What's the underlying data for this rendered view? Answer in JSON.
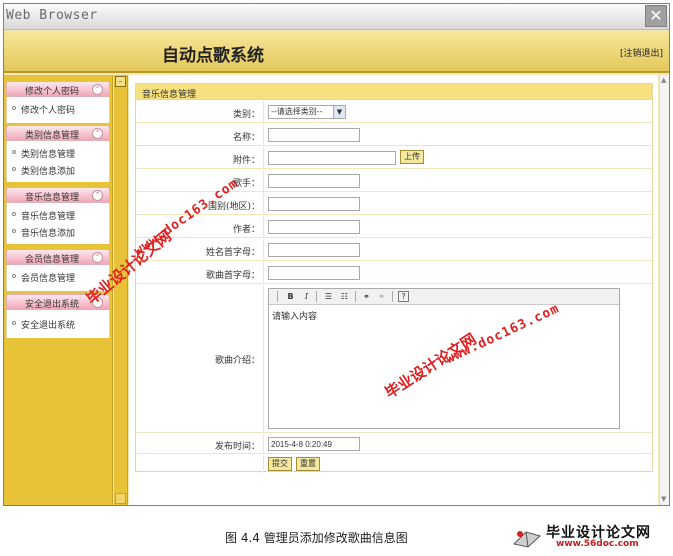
{
  "window": {
    "title": "Web Browser",
    "close_glyph": "✕"
  },
  "app": {
    "title": "自动点歌系统",
    "logout": "[注销退出]"
  },
  "sidebar": {
    "groups": [
      {
        "header": "修改个人密码",
        "items": [
          "修改个人密码"
        ]
      },
      {
        "header": "类别信息管理",
        "items": [
          "类别信息管理",
          "类别信息添加"
        ]
      },
      {
        "header": "音乐信息管理",
        "items": [
          "音乐信息管理",
          "音乐信息添加"
        ]
      },
      {
        "header": "会员信息管理",
        "items": [
          "会员信息管理"
        ]
      },
      {
        "header": "安全退出系统",
        "items": [
          "安全退出系统"
        ]
      }
    ],
    "toggle_glyph": "⌃"
  },
  "form": {
    "section_title": "音乐信息管理",
    "fields": {
      "category": {
        "label": "类别：",
        "value": "--请选择类别--"
      },
      "name": {
        "label": "名称：",
        "value": ""
      },
      "attachment": {
        "label": "附件：",
        "value": "",
        "upload": "上传"
      },
      "singer": {
        "label": "歌手：",
        "value": ""
      },
      "region": {
        "label": "国别(地区)：",
        "value": ""
      },
      "author": {
        "label": "作者：",
        "value": ""
      },
      "name_initial": {
        "label": "姓名首字母：",
        "value": ""
      },
      "song_initial": {
        "label": "歌曲首字母：",
        "value": ""
      },
      "intro": {
        "label": "歌曲介绍：",
        "placeholder": "请输入内容"
      },
      "publish_time": {
        "label": "发布时间：",
        "value": "2015-4-8 0:20:49"
      }
    },
    "submit": "提交",
    "reset": "重置"
  },
  "editor_toolbar": {
    "bold": "B",
    "italic": "I",
    "ordered_list_icon": "ordered-list-icon",
    "unordered_list_icon": "unordered-list-icon",
    "link_icon": "link-icon",
    "unlink_icon": "unlink-icon",
    "help": "?"
  },
  "watermarks": {
    "cn": "毕业设计论文网",
    "url": "www.doc163.com"
  },
  "caption": "图 4.4  管理员添加修改歌曲信息图",
  "logo": {
    "name": "毕业设计论文网",
    "url": "www.56doc.com"
  },
  "colors": {
    "accent": "#e8c338",
    "menu_header": "#f2a7b8",
    "watermark": "#e02020"
  }
}
